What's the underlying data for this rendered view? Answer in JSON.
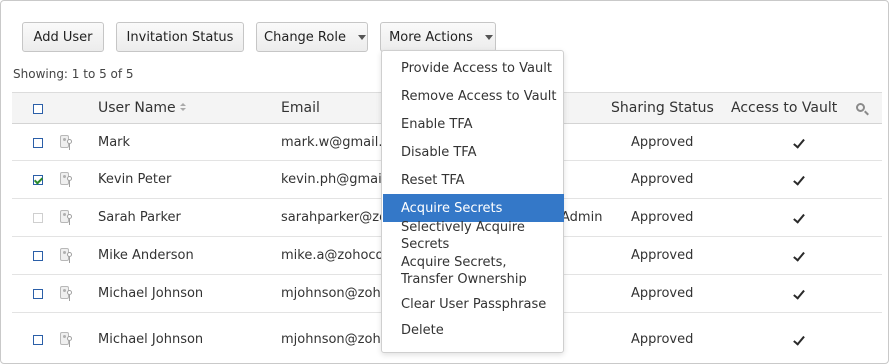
{
  "toolbar": {
    "add_user": "Add User",
    "invitation_status": "Invitation Status",
    "change_role": "Change Role",
    "more_actions": "More Actions"
  },
  "showing": "Showing: 1 to 5 of 5",
  "table": {
    "headers": {
      "user_name": "User Name",
      "email": "Email",
      "sharing_status": "Sharing Status",
      "access_to_vault": "Access to Vault"
    },
    "rows": [
      {
        "name": "Mark",
        "email": "mark.w@gmail.com",
        "role": "",
        "sharing_status": "Approved",
        "access": true,
        "checked": false,
        "disabled": false
      },
      {
        "name": "Kevin Peter",
        "email": "kevin.ph@gmail.com",
        "role": "",
        "sharing_status": "Approved",
        "access": true,
        "checked": true,
        "disabled": false
      },
      {
        "name": "Sarah Parker",
        "email": "sarahparker@zohocorp.com",
        "role": "Admin",
        "sharing_status": "Approved",
        "access": true,
        "checked": false,
        "disabled": true
      },
      {
        "name": "Mike Anderson",
        "email": "mike.a@zohocorp.com",
        "role": "",
        "sharing_status": "Approved",
        "access": true,
        "checked": false,
        "disabled": false
      },
      {
        "name": "Michael Johnson",
        "email": "mjohnson@zohocorp.com",
        "role": "",
        "sharing_status": "Approved",
        "access": true,
        "checked": false,
        "disabled": false
      },
      {
        "name": "Michael Johnson",
        "email": "mjohnson@zohocorp.com",
        "role": "",
        "sharing_status": "Approved",
        "access": true,
        "checked": false,
        "disabled": false
      }
    ]
  },
  "more_actions_menu": {
    "items": [
      {
        "label": "Provide Access to Vault",
        "active": false
      },
      {
        "label": "Remove Access to Vault",
        "active": false
      },
      {
        "label": "Enable TFA",
        "active": false
      },
      {
        "label": "Disable TFA",
        "active": false
      },
      {
        "label": "Reset TFA",
        "active": false
      },
      {
        "label": "Acquire Secrets",
        "active": true
      },
      {
        "label": "Selectively Acquire Secrets",
        "active": false
      },
      {
        "label": "Acquire Secrets, Transfer Ownership",
        "active": false
      },
      {
        "label": "Clear User Passphrase",
        "active": false
      },
      {
        "label": "Delete",
        "active": false
      }
    ]
  },
  "colors": {
    "menu_highlight": "#3478c8",
    "checkbox_border": "#2b5fa8",
    "header_bg": "#f4f4f4"
  }
}
